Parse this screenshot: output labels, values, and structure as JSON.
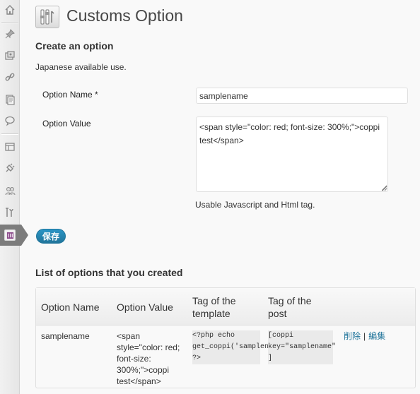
{
  "header": {
    "title": "Customs Option"
  },
  "create": {
    "heading": "Create an option",
    "note": "Japanese available use.",
    "name_label": "Option Name *",
    "name_value": "samplename",
    "value_label": "Option Value",
    "value_text": "<span style=\"color: red; font-size: 300%;\">coppi test</span>",
    "hint": "Usable Javascript and Html tag.",
    "save_label": "保存"
  },
  "list": {
    "heading": "List of options that you created",
    "columns": [
      "Option Name",
      "Option Value",
      "Tag of the template",
      "Tag of the post"
    ],
    "rows": [
      {
        "name": "samplename",
        "value": "<span style=\"color: red; font-size: 300%;\">coppi test</span>",
        "template_tag": "<?php echo get_coppi('samplename'); ?>",
        "post_tag": "[coppi key=\"samplename\" ]",
        "delete_label": "削除",
        "separator": "|",
        "edit_label": "編集"
      }
    ]
  },
  "sidebar": {
    "icons": [
      "dashboard-icon",
      "pin-icon",
      "media-icon",
      "links-icon",
      "pages-icon",
      "comments-icon",
      "appearance-icon",
      "plugins-icon",
      "users-icon",
      "tools-icon",
      "customs-option-icon"
    ]
  },
  "colors": {
    "accent": "#21759b",
    "active_menu": "#7c7c7c"
  }
}
